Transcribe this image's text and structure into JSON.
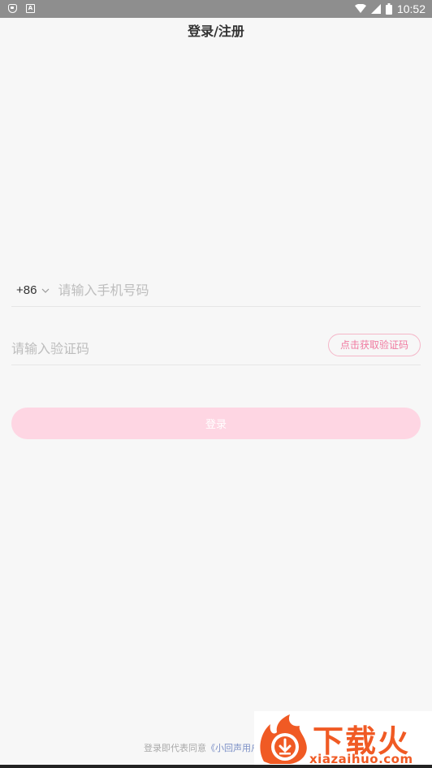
{
  "status_bar": {
    "time": "10:52",
    "icons": [
      "shield-icon",
      "a-letter-icon",
      "wifi-icon",
      "signal-icon",
      "battery-icon"
    ]
  },
  "header": {
    "title": "登录/注册"
  },
  "login_form": {
    "country_code": "+86",
    "phone_placeholder": "请输入手机号码",
    "phone_value": "",
    "code_placeholder": "请输入验证码",
    "code_value": "",
    "get_code_label": "点击获取验证码",
    "login_label": "登录"
  },
  "footer": {
    "agreement_prefix": "登录即代表同意",
    "agreement_link": "《小回声用户"
  },
  "watermark": {
    "brand": "下载火",
    "domain": "xiazaihuo.com"
  },
  "colors": {
    "accent_pink": "#f07aa0",
    "button_pink": "#fed6e3",
    "watermark_orange": "#f05a24"
  }
}
